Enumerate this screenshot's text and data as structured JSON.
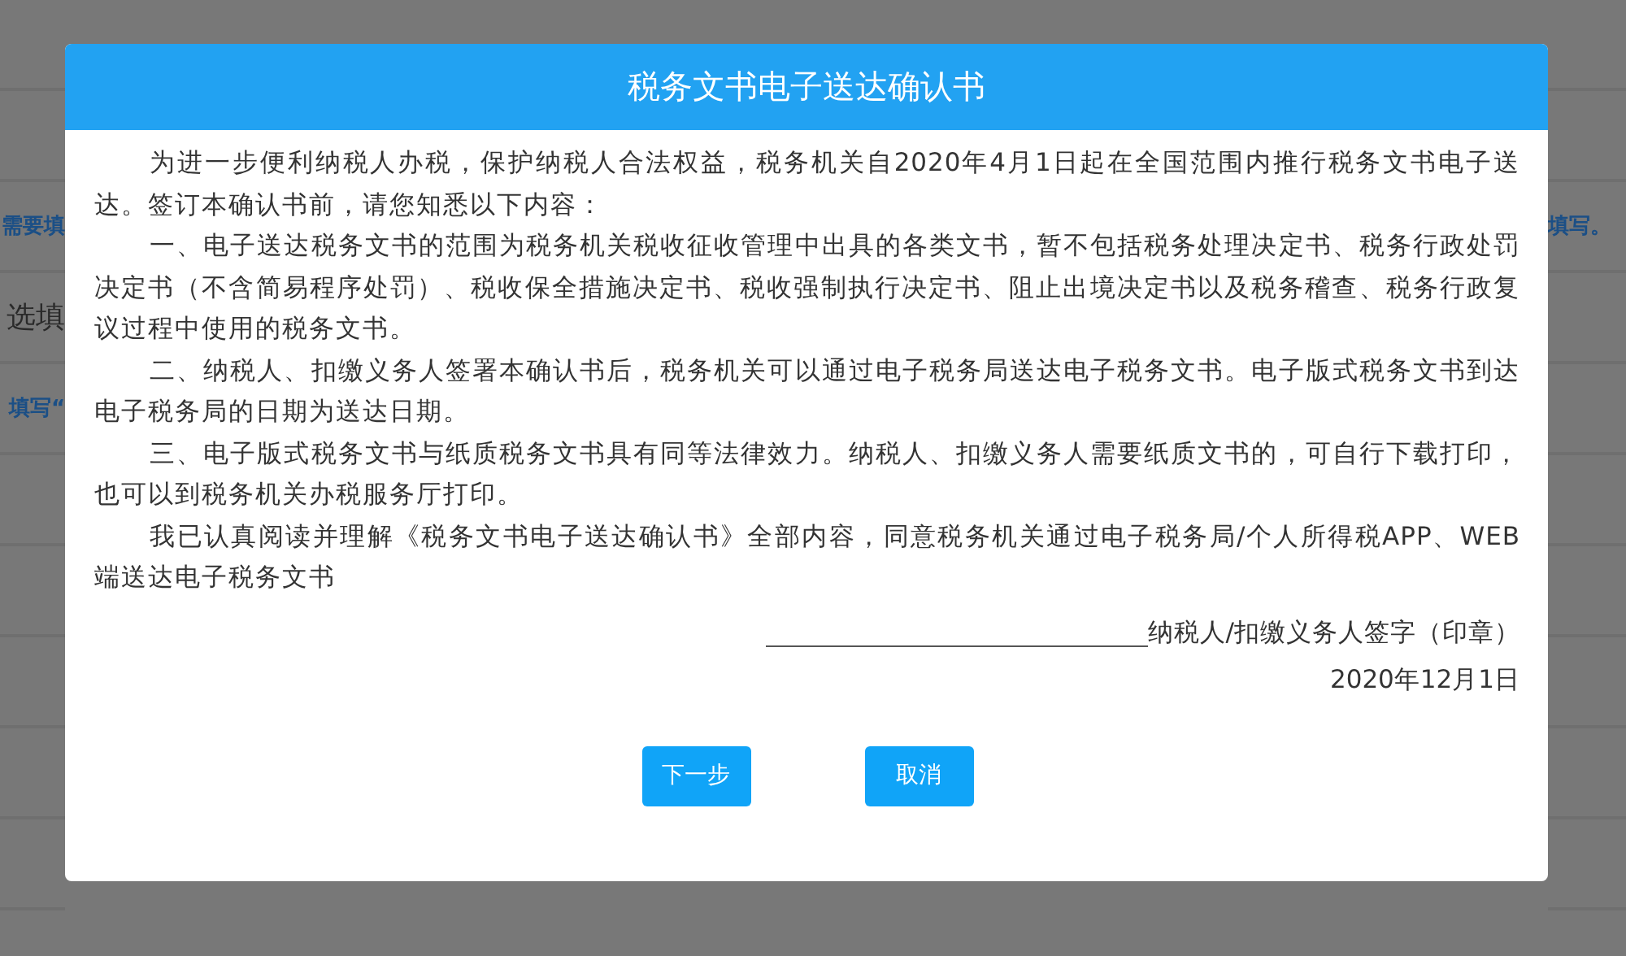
{
  "background": {
    "left_texts": [
      {
        "text": "需要填",
        "kind": "link"
      },
      {
        "text": "选填",
        "kind": "heading"
      },
      {
        "text": "填写“",
        "kind": "link"
      }
    ],
    "right_texts": [
      {
        "text": "填写。",
        "kind": "link"
      }
    ]
  },
  "dialog": {
    "title": "税务文书电子送达确认书",
    "paragraphs": [
      "为进一步便利纳税人办税，保护纳税人合法权益，税务机关自2020年4月1日起在全国范围内推行税务文书电子送达。签订本确认书前，请您知悉以下内容：",
      "一、电子送达税务文书的范围为税务机关税收征收管理中出具的各类文书，暂不包括税务处理决定书、税务行政处罚决定书（不含简易程序处罚）、税收保全措施决定书、税收强制执行决定书、阻止出境决定书以及税务稽查、税务行政复议过程中使用的税务文书。",
      "二、纳税人、扣缴义务人签署本确认书后，税务机关可以通过电子税务局送达电子税务文书。电子版式税务文书到达电子税务局的日期为送达日期。",
      "三、电子版式税务文书与纸质税务文书具有同等法律效力。纳税人、扣缴义务人需要纸质文书的，可自行下载打印，也可以到税务机关办税服务厅打印。",
      "我已认真阅读并理解《税务文书电子送达确认书》全部内容，同意税务机关通过电子税务局/个人所得税APP、WEB端送达电子税务文书"
    ],
    "signature_label": "纳税人/扣缴义务人签字（印章）",
    "date": "2020年12月1日",
    "buttons": [
      "下一步",
      "取消"
    ]
  }
}
